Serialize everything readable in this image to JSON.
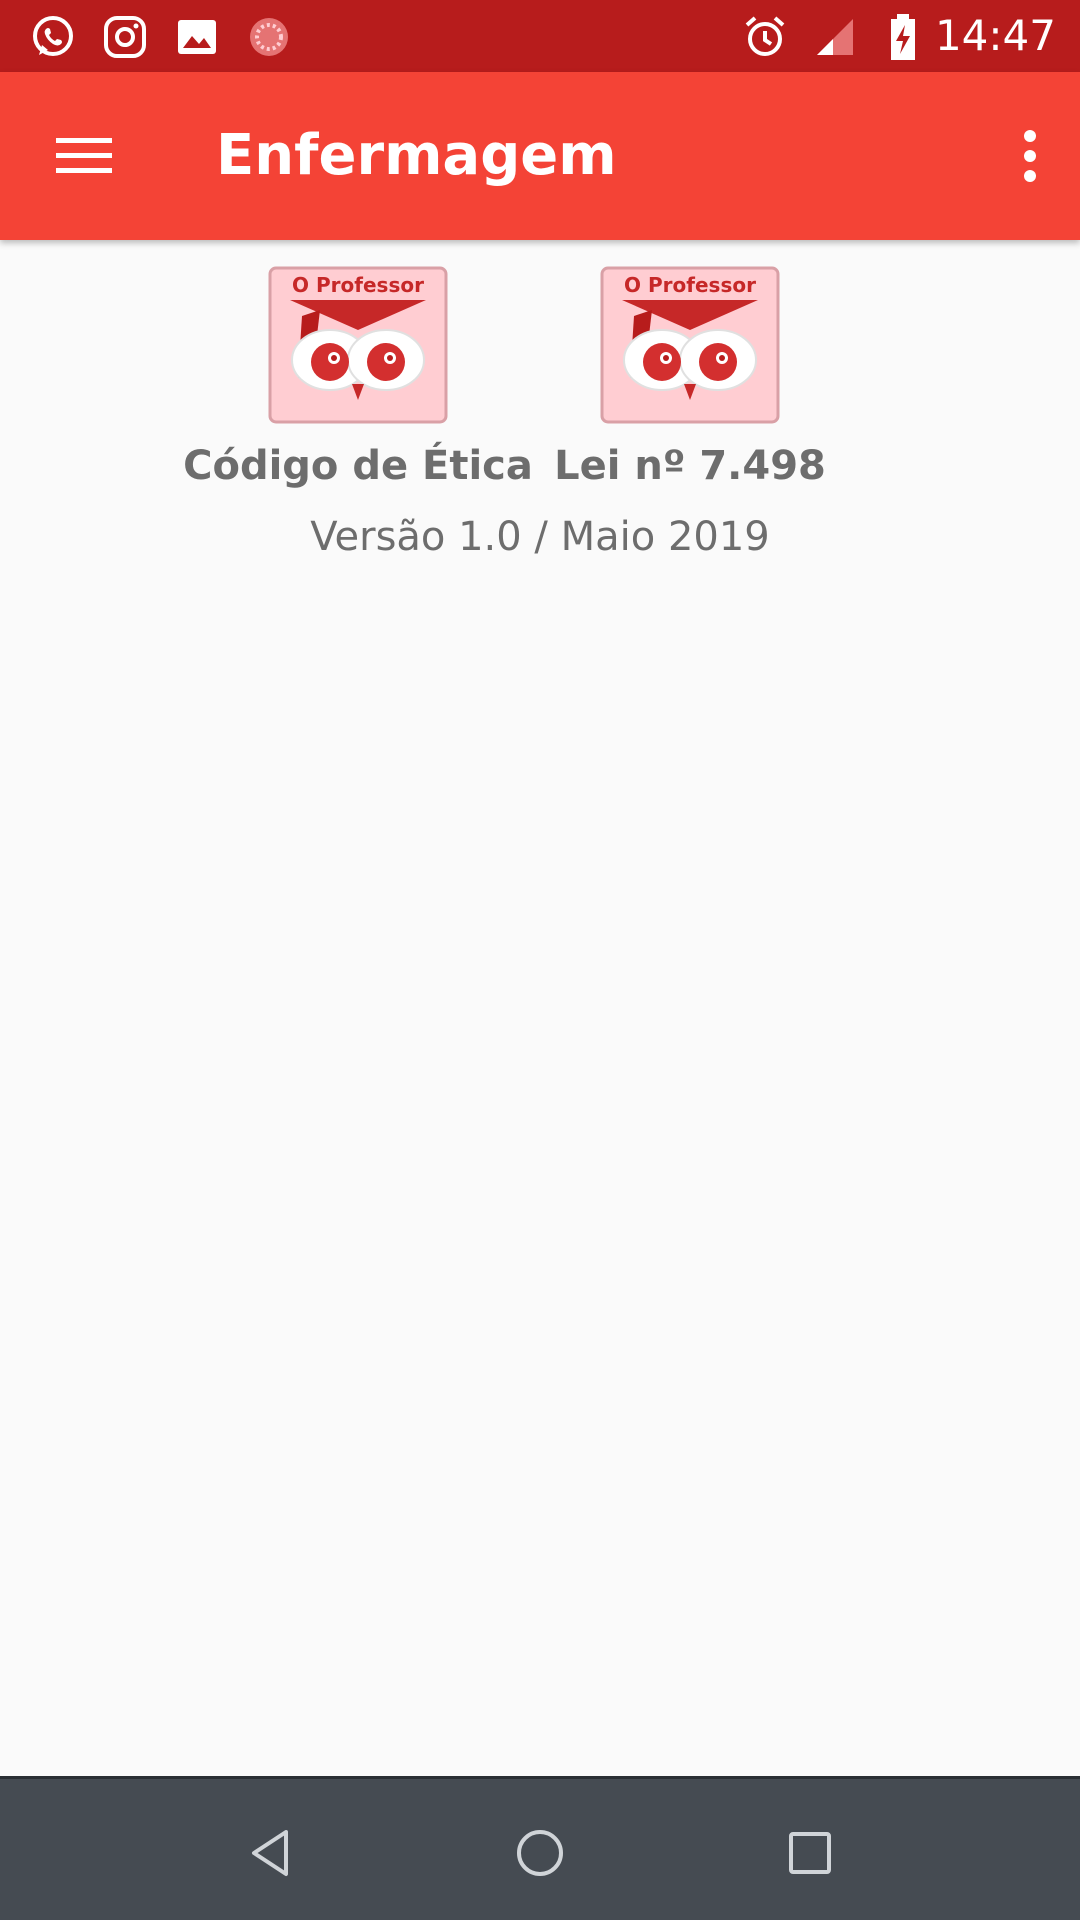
{
  "status_bar": {
    "time": "14:47",
    "left_icons": [
      "whatsapp-icon",
      "instagram-icon",
      "gallery-icon",
      "loading-icon"
    ],
    "right_icons": [
      "alarm-icon",
      "signal-icon",
      "battery-charging-icon"
    ],
    "background": "#b71c1c"
  },
  "app_bar": {
    "title": "Enfermagem",
    "menu_icon": "hamburger-menu-icon",
    "more_icon": "more-vert-icon",
    "background": "#f44336"
  },
  "tiles": [
    {
      "logo_text": "O Professor",
      "label": "Código de Ética"
    },
    {
      "logo_text": "O Professor",
      "label": "Lei nº 7.498"
    }
  ],
  "version": "Versão 1.0 / Maio 2019",
  "nav_bar": {
    "buttons": [
      "back-icon",
      "home-icon",
      "recents-icon"
    ],
    "background": "#454b52"
  }
}
